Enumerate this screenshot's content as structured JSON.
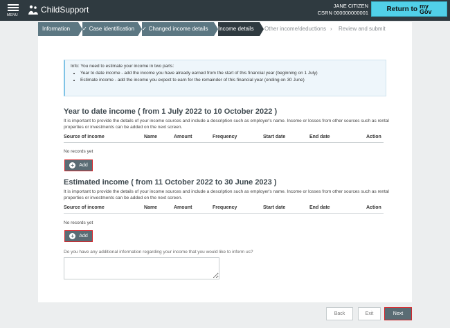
{
  "header": {
    "menu_label": "MENU",
    "brand": "ChildSupport",
    "user_name": "JANE CITIZEN",
    "csrn": "CSRN 000000000001",
    "mygov_prefix": "Return to",
    "mygov_top": "my",
    "mygov_bottom": "Gov"
  },
  "steps": [
    {
      "label": "Information",
      "state": "done",
      "check": ""
    },
    {
      "label": "Case identification",
      "state": "done",
      "check": "✓"
    },
    {
      "label": "Changed income details",
      "state": "done",
      "check": "✓"
    },
    {
      "label": "Income details",
      "state": "active",
      "check": ""
    },
    {
      "label": "Other income/deductions",
      "state": "todo",
      "check": ""
    },
    {
      "label": "Review and submit",
      "state": "todo",
      "check": ""
    }
  ],
  "info": {
    "intro": "Info: You need to estimate your income in two parts:",
    "bullets": [
      "Year to date income - add the income you have already earned from the start of this financial year (beginning on 1 July)",
      "Estimate income - add the income you expect to earn for the remainder of this financial year (ending on 30 June)"
    ]
  },
  "ytd": {
    "title": "Year to date income ( from 1 July 2022 to 10 October 2022 )",
    "desc": "It is important to provide the details of your income sources and include a description such as employer's name. Income or losses from other sources such as rental properties or investments can be added on the next screen.",
    "no_records": "No records yet",
    "add_label": "Add"
  },
  "est": {
    "title": "Estimated income ( from 11 October 2022 to 30 June 2023 )",
    "desc": "It is important to provide the details of your income sources and include a description such as employer's name. Income or losses from other sources such as rental properties or investments can be added on the next screen.",
    "no_records": "No records yet",
    "add_label": "Add"
  },
  "columns": [
    "Source of income",
    "Name",
    "Amount",
    "Frequency",
    "Start date",
    "End date",
    "Action"
  ],
  "additional": {
    "question": "Do you have any additional information regarding your income that you would like to inform us?",
    "value": ""
  },
  "footer": {
    "back": "Back",
    "exit": "Exit",
    "next": "Next"
  }
}
